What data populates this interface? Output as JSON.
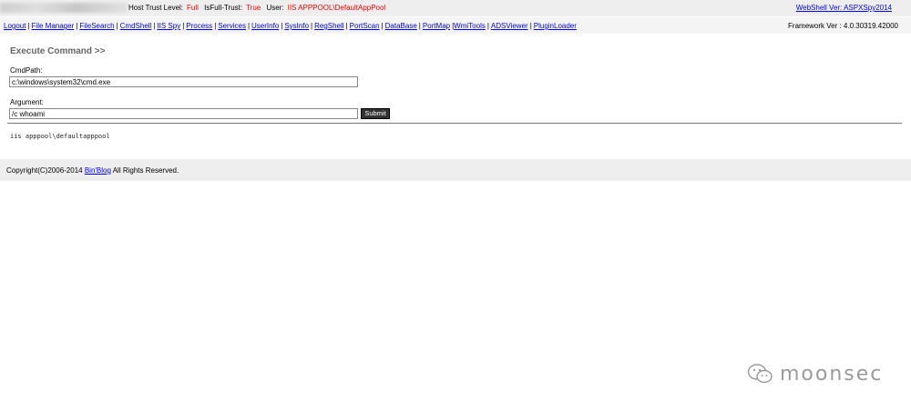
{
  "top": {
    "trust_label": "Host Trust Level:",
    "trust_value": "Full",
    "fulltrust_label": "IsFull-Trust:",
    "fulltrust_value": "True",
    "user_label": "User:",
    "user_value": "IIS APPPOOL\\DefaultAppPool",
    "version_link": "WebShell Ver: ASPXSpy2014"
  },
  "nav": {
    "items": [
      "Logout",
      "File Manager",
      "FileSearch",
      "CmdShell",
      "IIS Spy",
      "Process",
      "Services",
      "UserInfo",
      "SysInfo",
      "RegShell",
      "PortScan",
      "DataBase",
      "PortMap",
      "WmiTools",
      "ADSViewer",
      "PluginLoader"
    ],
    "framework": "Framework Ver : 4.0.30319.42000"
  },
  "main": {
    "title": "Execute Command >>",
    "cmdpath_label": "CmdPath:",
    "cmdpath_value": "c:\\windows\\system32\\cmd.exe",
    "argument_label": "Argument:",
    "argument_value": "/c whoami",
    "submit_label": "Submit",
    "output": "iis apppool\\defaultapppool"
  },
  "footer": {
    "prefix": "Copyright(C)2006-2014 ",
    "link": "Bin'Blog",
    "suffix": " All Rights Reserved."
  },
  "watermark": {
    "text": "moonsec",
    "icon": "wechat-icon"
  },
  "colors": {
    "link": "#0000ff",
    "alert": "#ff0000",
    "bar": "#eeeeee"
  }
}
